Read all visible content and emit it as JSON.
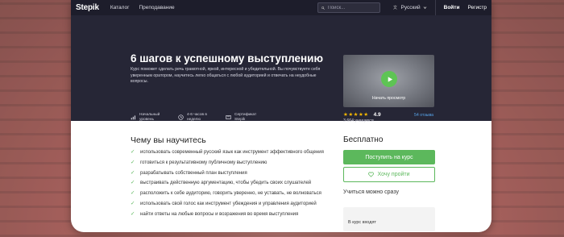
{
  "nav": {
    "logo": "Stepik",
    "links": [
      "Каталог",
      "Преподавание"
    ],
    "search_placeholder": "Поиск...",
    "language": "Русский",
    "login": "Войти",
    "register": "Регистр"
  },
  "hero": {
    "title": "6 шагов к успешному выступлению",
    "description": "Курс поможет сделать речь грамотной, яркой, интересной и убедительной. Вы почувствуете себя уверенным оратором, научитесь легко общаться с любой аудиторией и отвечать на неудобные вопросы.",
    "meta": [
      {
        "icon": "level-bars-icon",
        "label": "Начальный уровень"
      },
      {
        "icon": "clock-icon",
        "label": "4-6 часов в неделю"
      },
      {
        "icon": "certificate-icon",
        "label": "Сертификат Stepik"
      }
    ],
    "video_caption": "Начать просмотр",
    "rating_value": "4.9",
    "stars": 5,
    "reviews": "54 отзыва",
    "learners": "3 664 учащихся"
  },
  "learn": {
    "title": "Чему вы научитесь",
    "items": [
      "использовать современный русский язык как инструмент эффективного общения",
      "готовиться к результативному публичному выступлению",
      "разрабатывать собственный план выступления",
      "выстраивать действенную аргументацию, чтобы убедить своих слушателей",
      "расположить к себе аудиторию, говорить уверенно, не уставать, не волноваться",
      "использовать свой голос как инструмент убеждения и управления аудиторией",
      "найти ответы на любые вопросы и возражения во время выступления"
    ]
  },
  "aside": {
    "price": "Бесплатно",
    "enroll_label": "Поступить на курс",
    "wish_label": "Хочу пройти",
    "start_text": "Учиться можно сразу",
    "includes_label": "В курс входят"
  },
  "colors": {
    "accent_green": "#5cb85c",
    "hero_bg": "#262636",
    "nav_bg": "#1d1d2b",
    "star": "#f5b800",
    "link_blue": "#57a3e8"
  }
}
